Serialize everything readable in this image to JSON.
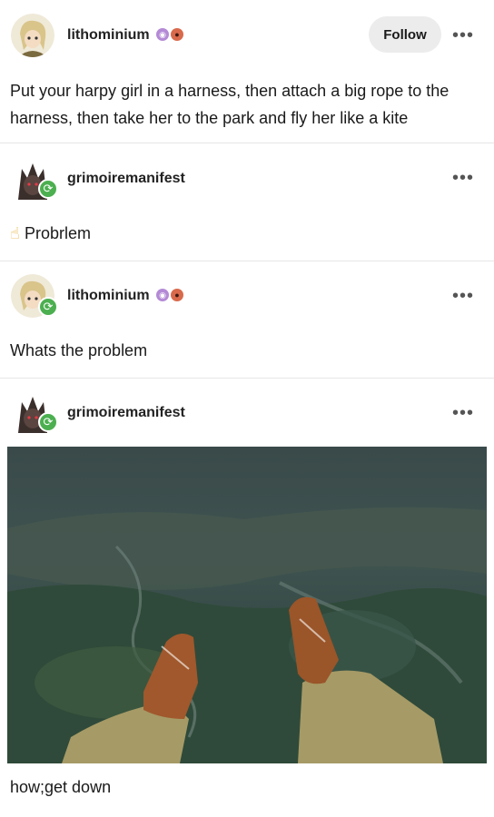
{
  "posts": [
    {
      "username": "lithominium",
      "follow_label": "Follow",
      "more_label": "•••",
      "text": "Put your harpy girl in a harness, then attach a big rope to the harness, then take her to the park and fly her like a kite"
    },
    {
      "username": "grimoiremanifest",
      "more_label": "•••",
      "emoji": "☝",
      "text": "Probrlem"
    },
    {
      "username": "lithominium",
      "more_label": "•••",
      "text": "Whats the problem"
    },
    {
      "username": "grimoiremanifest",
      "more_label": "•••",
      "caption": "how;get down"
    }
  ],
  "icons": {
    "reblog": "reblog-icon",
    "badge_colors": [
      "#9b59b6",
      "#c0392b"
    ]
  }
}
